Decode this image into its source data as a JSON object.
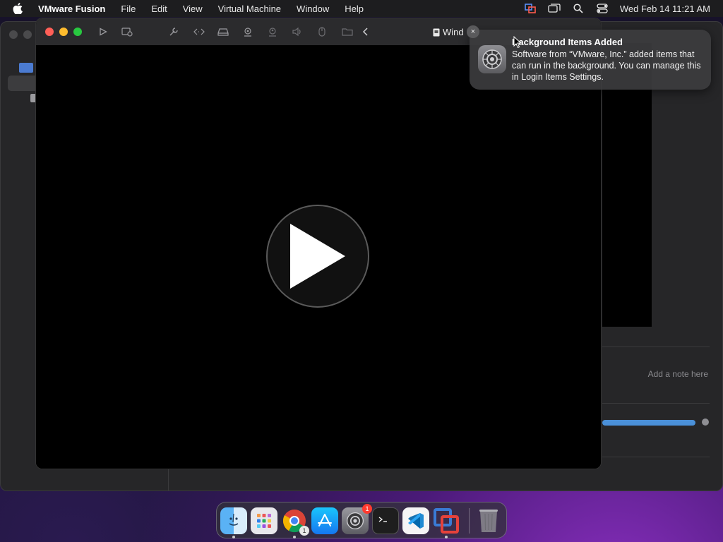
{
  "menubar": {
    "app_name": "VMware Fusion",
    "items": [
      "File",
      "Edit",
      "View",
      "Virtual Machine",
      "Window",
      "Help"
    ],
    "clock": "Wed Feb 14  11:21 AM"
  },
  "vm_window": {
    "title": "Wind",
    "close_glyph": "×"
  },
  "library": {
    "note_placeholder": "Add a note here"
  },
  "notification": {
    "title": "Background Items Added",
    "body": "Software from “VMware, Inc.” added items that can run in the background. You can manage this in Login Items Settings.",
    "close_glyph": "×"
  },
  "dock": {
    "items": [
      {
        "name": "finder-icon",
        "badge": ""
      },
      {
        "name": "launchpad-icon",
        "badge": ""
      },
      {
        "name": "chrome-icon",
        "badge": "1"
      },
      {
        "name": "app-store-icon",
        "badge": ""
      },
      {
        "name": "system-settings-icon",
        "badge": "1"
      },
      {
        "name": "terminal-icon",
        "badge": ""
      },
      {
        "name": "vscode-icon",
        "badge": ""
      },
      {
        "name": "vmware-fusion-icon",
        "badge": ""
      },
      {
        "name": "trash-icon",
        "badge": ""
      }
    ]
  },
  "colors": {
    "close": "#ff5f57",
    "minimize": "#febc2e",
    "maximize": "#28c840",
    "progress": "#4a90d9",
    "badge": "#ff3b30"
  }
}
